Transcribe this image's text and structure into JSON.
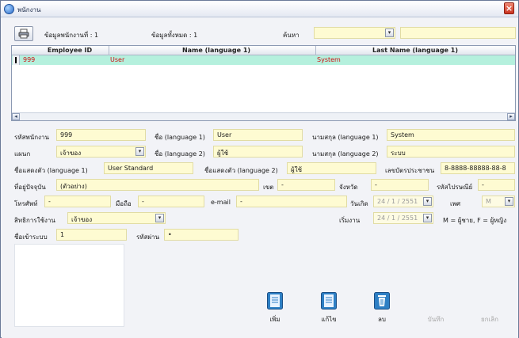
{
  "window": {
    "title": "พนักงาน"
  },
  "toolbar": {
    "employee_count_label": "ข้อมูลพนักงานที่ : 1",
    "total_count_label": "ข้อมูลทั้งหมด : 1",
    "search_label": "ค้นหา",
    "search_value": "",
    "search_text": ""
  },
  "grid": {
    "columns": [
      "Employee ID",
      "Name (language 1)",
      "Last Name (language 1)"
    ],
    "rows": [
      {
        "id": "999",
        "name": "User",
        "last_name": "System"
      }
    ]
  },
  "form": {
    "emp_code_label": "รหัสพนักงาน",
    "emp_code": "999",
    "name1_label": "ชื่อ (language 1)",
    "name1": "User",
    "last1_label": "นามสกุล (language 1)",
    "last1": "System",
    "dept_label": "แผนก",
    "dept": "เจ้าของ",
    "name2_label": "ชื่อ (language 2)",
    "name2": "ผู้ใช้",
    "last2_label": "นามสกุล (language 2)",
    "last2": "ระบบ",
    "display1_label": "ชื่อแสดงตัว (language 1)",
    "display1": "User Standard",
    "display2_label": "ชื่อแสดงตัว (language 2)",
    "display2": "ผู้ใช้",
    "national_id_label": "เลขบัตรประชาชน",
    "national_id": "8-8888-88888-88-8",
    "address_label": "ที่อยู่ปัจจุบัน",
    "address": "(ตัวอย่าง)",
    "district_label": "เขต",
    "district": "-",
    "province_label": "จังหวัด",
    "province": "-",
    "postal_label": "รหัสไปรษณีย์",
    "postal": "-",
    "phone_label": "โทรศัพท์",
    "phone": "-",
    "mobile_label": "มือถือ",
    "mobile": "-",
    "email_label": "e-mail",
    "email": "-",
    "birth_label": "วันเกิด",
    "birth": "24 / 1 / 2551",
    "gender_label": "เพศ",
    "gender": "M",
    "rights_label": "สิทธิการใช้งาน",
    "rights": "เจ้าของ",
    "start_label": "เริ่มงาน",
    "start": "24 / 1 / 2551",
    "gender_hint": "M = ผู้ชาย, F = ผู้หญิง",
    "login_label": "ชื่อเข้าระบบ",
    "login": "1",
    "password_label": "รหัสผ่าน",
    "password": "•"
  },
  "actions": {
    "add": "เพิ่ม",
    "edit": "แก้ไข",
    "delete": "ลบ",
    "save": "บันทึก",
    "cancel": "ยกเลิก"
  },
  "colors": {
    "selected_row": "#b5f0dd",
    "field_bg": "#fefbd2",
    "row_text": "#cc1111"
  }
}
